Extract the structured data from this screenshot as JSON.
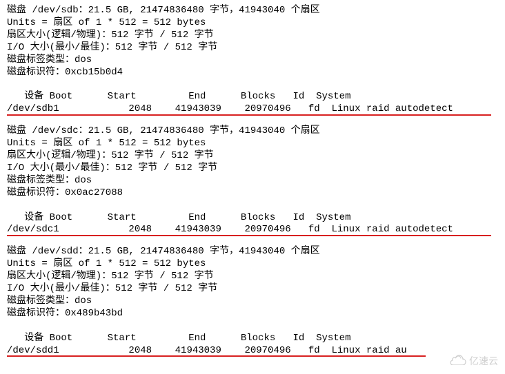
{
  "disks": [
    {
      "header1": "磁盘 /dev/sdb：21.5 GB, 21474836480 字节，41943040 个扇区",
      "header2": "Units = 扇区 of 1 * 512 = 512 bytes",
      "header3": "扇区大小(逻辑/物理)：512 字节 / 512 字节",
      "header4": "I/O 大小(最小/最佳)：512 字节 / 512 字节",
      "header5": "磁盘标签类型：dos",
      "header6": "磁盘标识符：0xcb15b0d4",
      "tableHeader": "   设备 Boot      Start         End      Blocks   Id  System",
      "tableRow": "/dev/sdb1            2048    41943039    20970496   fd  Linux raid autodetect"
    },
    {
      "header1": "磁盘 /dev/sdc：21.5 GB, 21474836480 字节，41943040 个扇区",
      "header2": "Units = 扇区 of 1 * 512 = 512 bytes",
      "header3": "扇区大小(逻辑/物理)：512 字节 / 512 字节",
      "header4": "I/O 大小(最小/最佳)：512 字节 / 512 字节",
      "header5": "磁盘标签类型：dos",
      "header6": "磁盘标识符：0x0ac27088",
      "tableHeader": "   设备 Boot      Start         End      Blocks   Id  System",
      "tableRow": "/dev/sdc1            2048    41943039    20970496   fd  Linux raid autodetect"
    },
    {
      "header1": "磁盘 /dev/sdd：21.5 GB, 21474836480 字节，41943040 个扇区",
      "header2": "Units = 扇区 of 1 * 512 = 512 bytes",
      "header3": "扇区大小(逻辑/物理)：512 字节 / 512 字节",
      "header4": "I/O 大小(最小/最佳)：512 字节 / 512 字节",
      "header5": "磁盘标签类型：dos",
      "header6": "磁盘标识符：0x489b43bd",
      "tableHeader": "   设备 Boot      Start         End      Blocks   Id  System",
      "tableRow": "/dev/sdd1            2048    41943039    20970496   fd  Linux raid au"
    }
  ],
  "watermark": {
    "text": "亿速云"
  }
}
